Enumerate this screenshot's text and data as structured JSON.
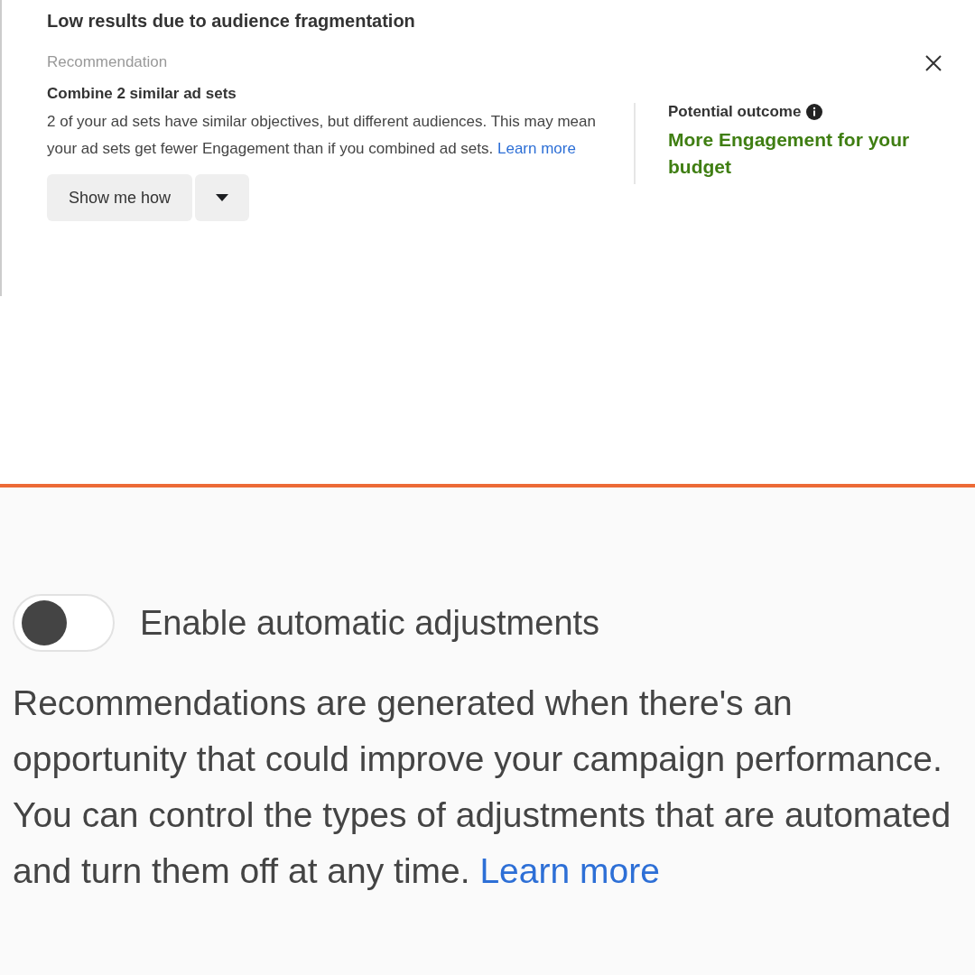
{
  "recommendation_card": {
    "title": "Low results due to audience fragmentation",
    "eyebrow": "Recommendation",
    "heading": "Combine 2 similar ad sets",
    "body": "2 of your ad sets have similar objectives, but different audiences. This may mean your ad sets get fewer Engagement than if you combined ad sets.",
    "link": "Learn more",
    "primary_button": "Show me how",
    "outcome_label": "Potential outcome",
    "outcome_value": "More Engagement for your budget"
  },
  "automation": {
    "toggle": {
      "label": "Enable automatic adjustments",
      "on": false
    },
    "description": "Recommendations are generated when there's an opportunity that could improve your campaign performance. You can control the types of adjustments that are automated and turn them off at any time.",
    "link": "Learn more"
  }
}
